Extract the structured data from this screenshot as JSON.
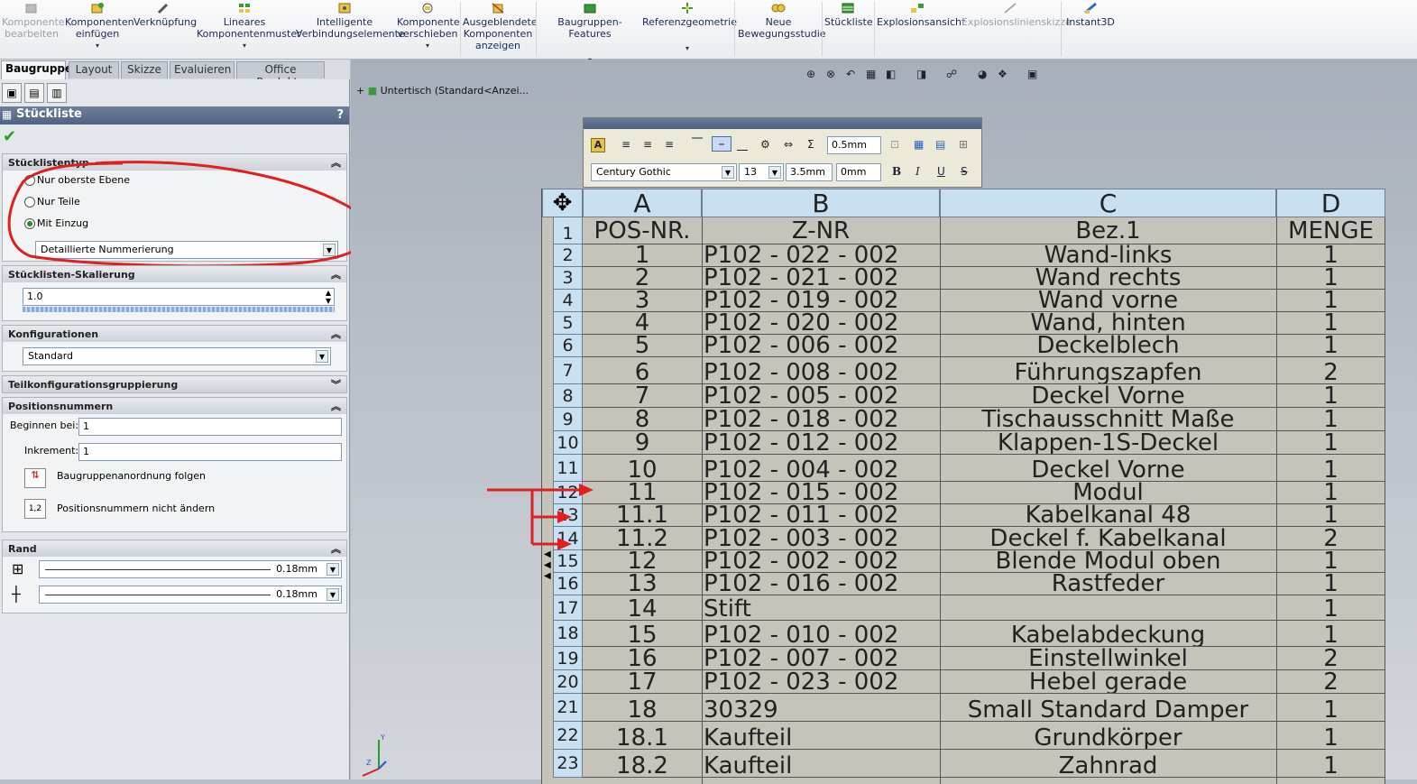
{
  "ribbon": {
    "items": [
      {
        "label": "Komponente bearbeiten",
        "icon": "edit-component-icon",
        "disabled": true
      },
      {
        "label": "Komponenten einfügen",
        "icon": "insert-components-icon"
      },
      {
        "label": "Verknüpfung",
        "icon": "mate-icon"
      },
      {
        "label": "Lineares Komponentenmuster",
        "icon": "linear-pattern-icon"
      },
      {
        "label": "Intelligente Verbindungselemente",
        "icon": "smart-fasteners-icon"
      },
      {
        "label": "Komponente verschieben",
        "icon": "move-component-icon"
      },
      {
        "label": "Ausgeblendete Komponenten anzeigen",
        "icon": "show-hidden-icon"
      },
      {
        "label": "Baugruppen-Features",
        "icon": "assembly-features-icon"
      },
      {
        "label": "Referenzgeometrie",
        "icon": "reference-geometry-icon"
      },
      {
        "label": "Neue Bewegungsstudie",
        "icon": "motion-study-icon"
      },
      {
        "label": "Stückliste",
        "icon": "bom-icon"
      },
      {
        "label": "Explosionsansicht",
        "icon": "exploded-view-icon"
      },
      {
        "label": "Explosionslinienskizze",
        "icon": "explode-line-icon",
        "disabled": true
      },
      {
        "label": "Instant3D",
        "icon": "instant3d-icon"
      }
    ]
  },
  "tabs": [
    "Baugruppe",
    "Layout",
    "Skizze",
    "Evaluieren",
    "Office Produkte"
  ],
  "panel": {
    "title": "Stückliste",
    "help": "?",
    "bomtype": {
      "header": "Stücklistentyp",
      "options": [
        "Nur oberste Ebene",
        "Nur Teile",
        "Mit Einzug"
      ],
      "selected": 2,
      "numbering": "Detaillierte Nummerierung"
    },
    "scale": {
      "header": "Stücklisten-Skalierung",
      "value": "1.0"
    },
    "config": {
      "header": "Konfigurationen",
      "value": "Standard"
    },
    "partgroup": {
      "header": "Teilkonfigurationsgruppierung"
    },
    "itemnum": {
      "header": "Positionsnummern",
      "start_label": "Beginnen bei:",
      "start_value": "1",
      "incr_label": "Inkrement:",
      "incr_value": "1",
      "follow_label": "Baugruppenanordnung folgen",
      "nochange_label": "Positionsnummern nicht ändern",
      "nochange_icon_text": "1,2"
    },
    "border": {
      "header": "Rand",
      "value1": "0.18mm",
      "value2": "0.18mm"
    }
  },
  "tree": {
    "label": "Untertisch  (Standard<Anzei..."
  },
  "format": {
    "font": "Century Gothic",
    "size": "13",
    "height": "3.5mm",
    "spacing": "0mm",
    "margin": "0.5mm",
    "bold": "B",
    "italic": "I",
    "underline": "U",
    "strike": "S"
  },
  "bom": {
    "columns": [
      "A",
      "B",
      "C",
      "D"
    ],
    "header_row": [
      "POS-NR.",
      "Z-NR",
      "Bez.1",
      "MENGE"
    ],
    "rows": [
      [
        "1",
        "P102 - 022 - 002",
        "Wand-links",
        "1"
      ],
      [
        "2",
        "P102 - 021 - 002",
        "Wand rechts",
        "1"
      ],
      [
        "3",
        "P102 - 019 - 002",
        "Wand vorne",
        "1"
      ],
      [
        "4",
        "P102 - 020 - 002",
        "Wand, hinten",
        "1"
      ],
      [
        "5",
        "P102 - 006 - 002",
        "Deckelblech",
        "1"
      ],
      [
        "6",
        "P102 - 008 - 002",
        "Führungszapfen",
        "2"
      ],
      [
        "7",
        "P102 - 005 - 002",
        "Deckel Vorne",
        "1"
      ],
      [
        "8",
        "P102 - 018 - 002",
        "Tischausschnitt Maße",
        "1"
      ],
      [
        "9",
        "P102 - 012 - 002",
        "Klappen-1S-Deckel",
        "1"
      ],
      [
        "10",
        "P102 - 004 - 002",
        "Deckel Vorne",
        "1"
      ],
      [
        "11",
        "P102 - 015 - 002",
        "Modul",
        "1"
      ],
      [
        "11.1",
        "P102 - 011 - 002",
        "Kabelkanal 48",
        "1"
      ],
      [
        "11.2",
        "P102 - 003 - 002",
        "Deckel f. Kabelkanal",
        "2"
      ],
      [
        "12",
        "P102 - 002 - 002",
        "Blende Modul oben",
        "1"
      ],
      [
        "13",
        "P102 - 016 - 002",
        "Rastfeder",
        "1"
      ],
      [
        "14",
        "Stift",
        "",
        "1"
      ],
      [
        "15",
        "P102 - 010 - 002",
        "Kabelabdeckung",
        "1"
      ],
      [
        "16",
        "P102 - 007 - 002",
        "Einstellwinkel",
        "2"
      ],
      [
        "17",
        "P102 - 023 - 002",
        "Hebel gerade",
        "2"
      ],
      [
        "18",
        "30329",
        "Small Standard Damper",
        "1"
      ],
      [
        "18.1",
        "Kaufteil",
        "Grundkörper",
        "1"
      ],
      [
        "18.2",
        "Kaufteil",
        "Zahnrad",
        "1"
      ]
    ]
  }
}
